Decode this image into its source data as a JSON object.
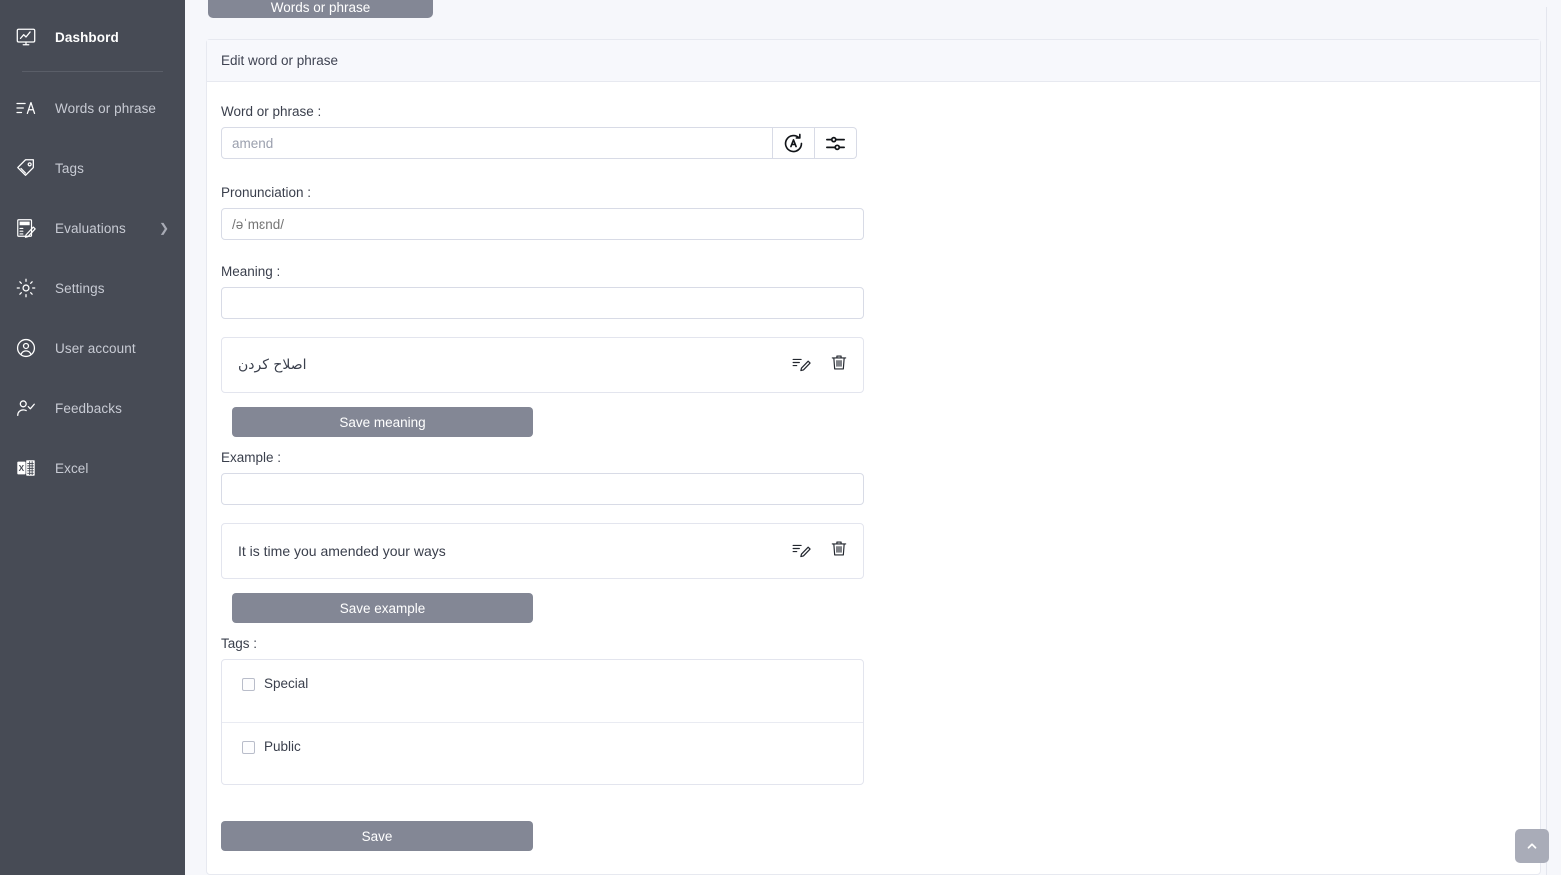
{
  "sidebar": {
    "items": [
      {
        "label": "Dashbord",
        "icon": "monitor-chart-icon",
        "active": true,
        "has_chevron": false
      },
      {
        "label": "Words or phrase",
        "icon": "text-lines-a-icon",
        "active": false,
        "has_chevron": false
      },
      {
        "label": "Tags",
        "icon": "tag-icon",
        "active": false,
        "has_chevron": false
      },
      {
        "label": "Evaluations",
        "icon": "exam-clipboard-pencil-icon",
        "active": false,
        "has_chevron": true
      },
      {
        "label": "Settings",
        "icon": "gear-icon",
        "active": false,
        "has_chevron": false
      },
      {
        "label": "User account",
        "icon": "user-circle-icon",
        "active": false,
        "has_chevron": false
      },
      {
        "label": "Feedbacks",
        "icon": "user-check-icon",
        "active": false,
        "has_chevron": false
      },
      {
        "label": "Excel",
        "icon": "excel-file-icon",
        "active": false,
        "has_chevron": false
      }
    ]
  },
  "main": {
    "top_button_label": "Words or phrase",
    "card_title": "Edit word or phrase",
    "word": {
      "label": "Word or phrase :",
      "value": "amend",
      "placeholder": "amend",
      "auto_button_icon": "a-in-circle-arrow-icon",
      "settings_button_icon": "sliders-icon"
    },
    "pronunciation": {
      "label": "Pronunciation :",
      "value": "/əˈmɛnd/",
      "placeholder": "/əˈmɛnd/"
    },
    "meaning": {
      "label": "Meaning :",
      "input_value": "",
      "input_placeholder": "",
      "items": [
        {
          "text": "اصلاح کردن",
          "edit_icon": "edit-pencil-icon",
          "delete_icon": "trash-icon"
        }
      ],
      "save_label": "Save meaning"
    },
    "example": {
      "label": "Example :",
      "input_value": "",
      "input_placeholder": "",
      "items": [
        {
          "text": "It is time you amended your ways",
          "edit_icon": "edit-pencil-icon",
          "delete_icon": "trash-icon"
        }
      ],
      "save_label": "Save example"
    },
    "tags": {
      "label": "Tags :",
      "items": [
        {
          "label": "Special",
          "checked": false
        },
        {
          "label": "Public",
          "checked": false
        }
      ]
    },
    "save_label": "Save",
    "scroll_top_icon": "chevron-up-icon"
  },
  "colors": {
    "sidebar_bg": "#474b55",
    "topbar_bg": "#3b3b40",
    "page_bg": "#f6f7fb",
    "button_bg": "#838795",
    "card_header_bg": "#f7f8fc",
    "border": "#e7e9f0",
    "scroll_top_bg": "#a9acb8"
  }
}
